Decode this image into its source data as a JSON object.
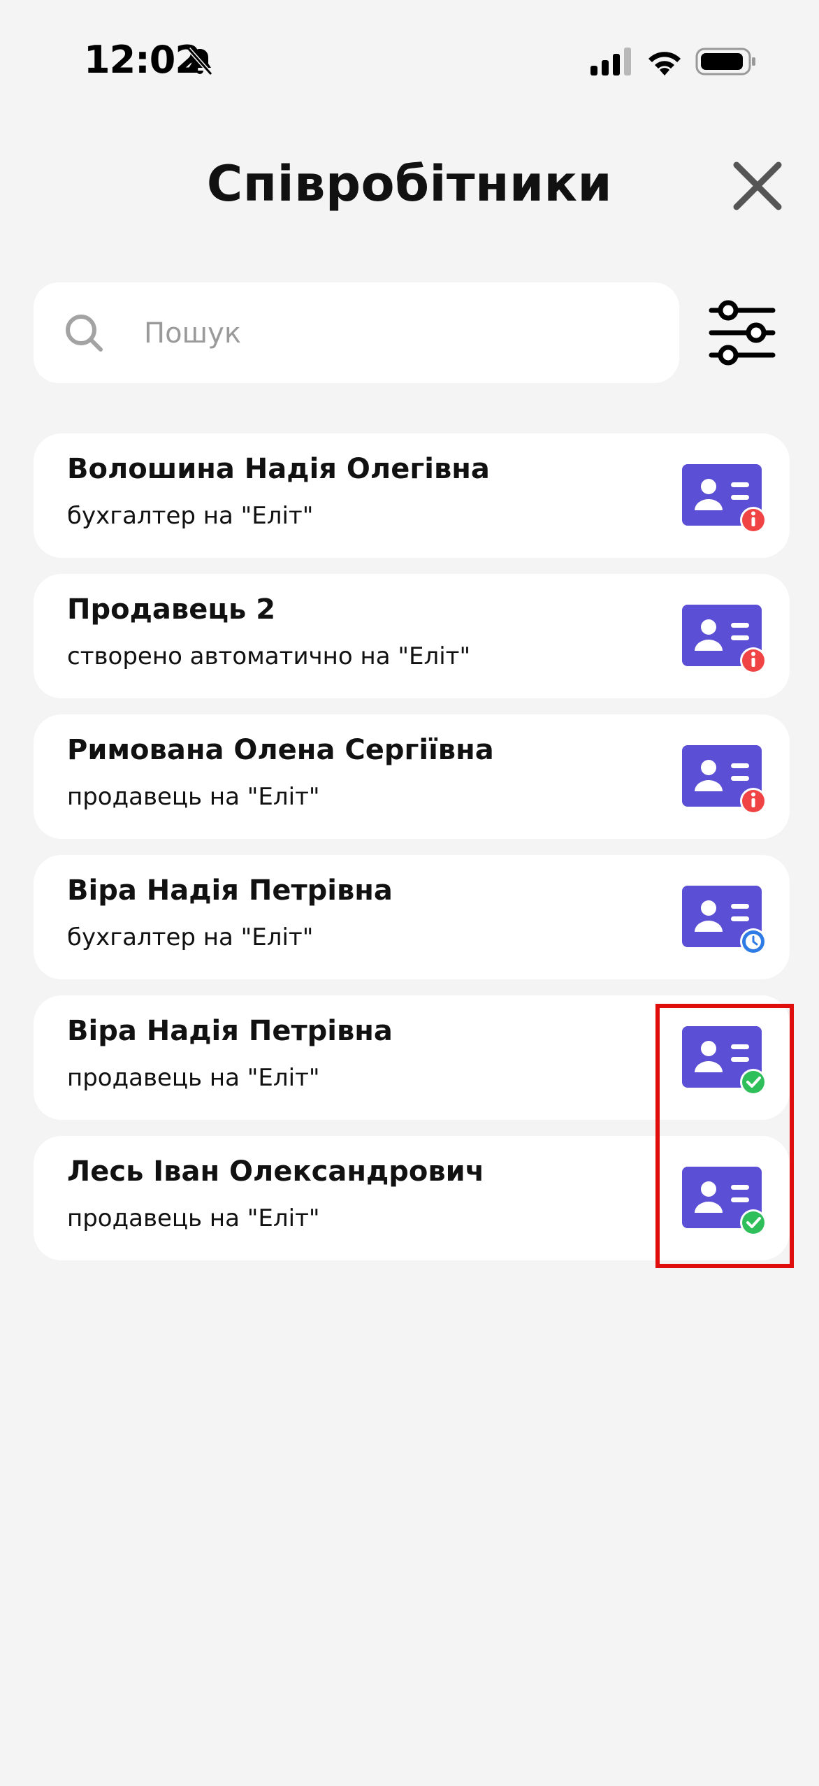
{
  "status_bar": {
    "time": "12:02",
    "icons": [
      "bell-slash-icon",
      "signal-icon",
      "wifi-icon",
      "battery-icon"
    ]
  },
  "header": {
    "title": "Співробітники",
    "close_icon": "close-icon"
  },
  "search": {
    "placeholder": "Пошук",
    "value": "",
    "icon": "search-icon"
  },
  "filter": {
    "icon": "sliders-icon"
  },
  "colors": {
    "background": "#f4f4f4",
    "card": "#ffffff",
    "id_card": "#5b4fd6",
    "status_info": "#f04444",
    "status_pending": "#2f7be6",
    "status_verified": "#2fbf5a",
    "highlight": "#e00d0d"
  },
  "employees": [
    {
      "name": "Волошина Надія Олегівна",
      "role": "бухгалтер на \"Еліт\"",
      "status": "info"
    },
    {
      "name": "Продавець 2",
      "role": "створено автоматично на \"Еліт\"",
      "status": "info"
    },
    {
      "name": "Римована Олена Сергіївна",
      "role": "продавець на \"Еліт\"",
      "status": "info"
    },
    {
      "name": "Віра Надія Петрівна",
      "role": "бухгалтер на \"Еліт\"",
      "status": "pending"
    },
    {
      "name": "Віра Надія Петрівна",
      "role": "продавець на \"Еліт\"",
      "status": "verified"
    },
    {
      "name": "Лесь Іван Олександрович",
      "role": "продавець на \"Еліт\"",
      "status": "verified"
    }
  ]
}
